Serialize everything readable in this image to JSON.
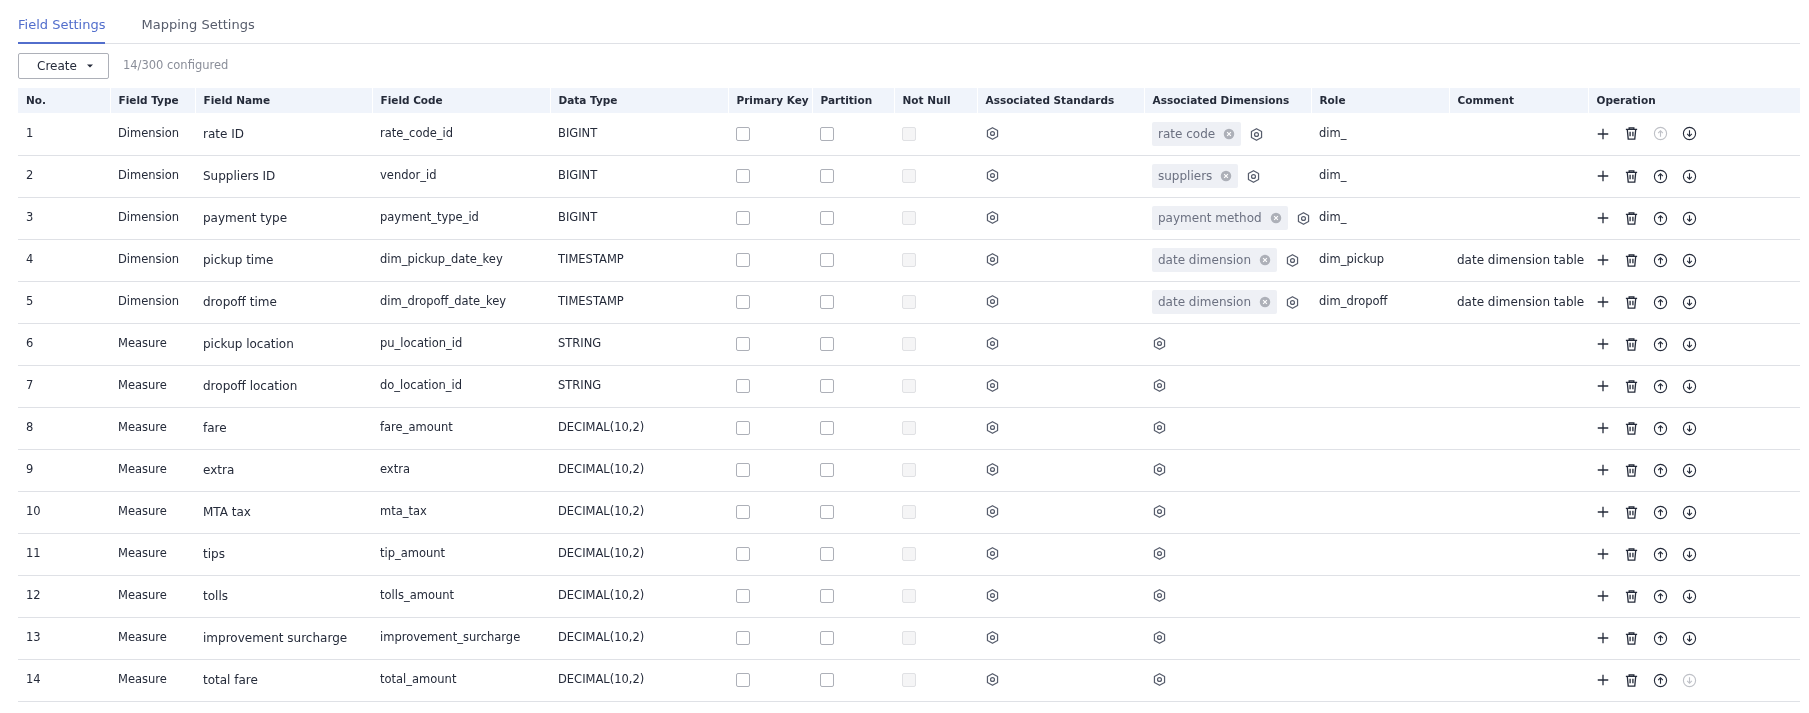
{
  "tabs": [
    {
      "label": "Field Settings",
      "selected": true
    },
    {
      "label": "Mapping Settings",
      "selected": false
    }
  ],
  "toolbar": {
    "create_button": "Create",
    "count": "14/300 configured"
  },
  "table": {
    "columns": [
      "No.",
      "Field Type",
      "Field Name",
      "Field Code",
      "Data Type",
      "Primary Key",
      "Partition",
      "Not Null",
      "Associated Standards",
      "Associated Dimensions",
      "Role",
      "Comment",
      "Operation"
    ],
    "rows": [
      {
        "no": "1",
        "field_type": "Dimension",
        "field_name": "rate ID",
        "field_code": "rate_code_id",
        "data_type": "BIGINT",
        "primary_key": false,
        "partition": false,
        "not_null": false,
        "not_null_disabled": true,
        "dimension": "rate code",
        "role": "dim_",
        "move_up_disabled": true,
        "move_down_disabled": false
      },
      {
        "no": "2",
        "field_type": "Dimension",
        "field_name": "Suppliers ID",
        "field_code": "vendor_id",
        "data_type": "BIGINT",
        "primary_key": false,
        "partition": false,
        "not_null": false,
        "not_null_disabled": true,
        "dimension": "suppliers",
        "role": "dim_",
        "move_up_disabled": false,
        "move_down_disabled": false
      },
      {
        "no": "3",
        "field_type": "Dimension",
        "field_name": "payment type",
        "field_code": "payment_type_id",
        "data_type": "BIGINT",
        "primary_key": false,
        "partition": false,
        "not_null": false,
        "not_null_disabled": true,
        "dimension": "payment method",
        "role": "dim_",
        "move_up_disabled": false,
        "move_down_disabled": false
      },
      {
        "no": "4",
        "field_type": "Dimension",
        "field_name": "pickup time",
        "field_code": "dim_pickup_date_key",
        "data_type": "TIMESTAMP",
        "primary_key": false,
        "partition": false,
        "not_null": false,
        "not_null_disabled": true,
        "dimension": "date dimension",
        "role": "dim_pickup",
        "comment": "date dimension table",
        "move_up_disabled": false,
        "move_down_disabled": false
      },
      {
        "no": "5",
        "field_type": "Dimension",
        "field_name": "dropoff time",
        "field_code": "dim_dropoff_date_key",
        "data_type": "TIMESTAMP",
        "primary_key": false,
        "partition": false,
        "not_null": false,
        "not_null_disabled": true,
        "dimension": "date dimension",
        "role": "dim_dropoff",
        "comment": "date dimension table",
        "move_up_disabled": false,
        "move_down_disabled": false
      },
      {
        "no": "6",
        "field_type": "Measure",
        "field_name": "pickup location",
        "field_code": "pu_location_id",
        "data_type": "STRING",
        "primary_key": false,
        "partition": false,
        "not_null": false,
        "not_null_disabled": true,
        "move_up_disabled": false,
        "move_down_disabled": false
      },
      {
        "no": "7",
        "field_type": "Measure",
        "field_name": "dropoff location",
        "field_code": "do_location_id",
        "data_type": "STRING",
        "primary_key": false,
        "partition": false,
        "not_null": false,
        "not_null_disabled": true,
        "move_up_disabled": false,
        "move_down_disabled": false
      },
      {
        "no": "8",
        "field_type": "Measure",
        "field_name": "fare",
        "field_code": "fare_amount",
        "data_type": "DECIMAL(10,2)",
        "primary_key": false,
        "partition": false,
        "not_null": false,
        "not_null_disabled": true,
        "move_up_disabled": false,
        "move_down_disabled": false
      },
      {
        "no": "9",
        "field_type": "Measure",
        "field_name": "extra",
        "field_code": "extra",
        "data_type": "DECIMAL(10,2)",
        "primary_key": false,
        "partition": false,
        "not_null": false,
        "not_null_disabled": true,
        "move_up_disabled": false,
        "move_down_disabled": false
      },
      {
        "no": "10",
        "field_type": "Measure",
        "field_name": "MTA tax",
        "field_code": "mta_tax",
        "data_type": "DECIMAL(10,2)",
        "primary_key": false,
        "partition": false,
        "not_null": false,
        "not_null_disabled": true,
        "move_up_disabled": false,
        "move_down_disabled": false
      },
      {
        "no": "11",
        "field_type": "Measure",
        "field_name": "tips",
        "field_code": "tip_amount",
        "data_type": "DECIMAL(10,2)",
        "primary_key": false,
        "partition": false,
        "not_null": false,
        "not_null_disabled": true,
        "move_up_disabled": false,
        "move_down_disabled": false
      },
      {
        "no": "12",
        "field_type": "Measure",
        "field_name": "tolls",
        "field_code": "tolls_amount",
        "data_type": "DECIMAL(10,2)",
        "primary_key": false,
        "partition": false,
        "not_null": false,
        "not_null_disabled": true,
        "move_up_disabled": false,
        "move_down_disabled": false
      },
      {
        "no": "13",
        "field_type": "Measure",
        "field_name": "improvement surcharge",
        "field_code": "improvement_surcharge",
        "data_type": "DECIMAL(10,2)",
        "primary_key": false,
        "partition": false,
        "not_null": false,
        "not_null_disabled": true,
        "move_up_disabled": false,
        "move_down_disabled": false
      },
      {
        "no": "14",
        "field_type": "Measure",
        "field_name": "total fare",
        "field_code": "total_amount",
        "data_type": "DECIMAL(10,2)",
        "primary_key": false,
        "partition": false,
        "not_null": false,
        "not_null_disabled": true,
        "move_up_disabled": false,
        "move_down_disabled": true
      }
    ]
  }
}
